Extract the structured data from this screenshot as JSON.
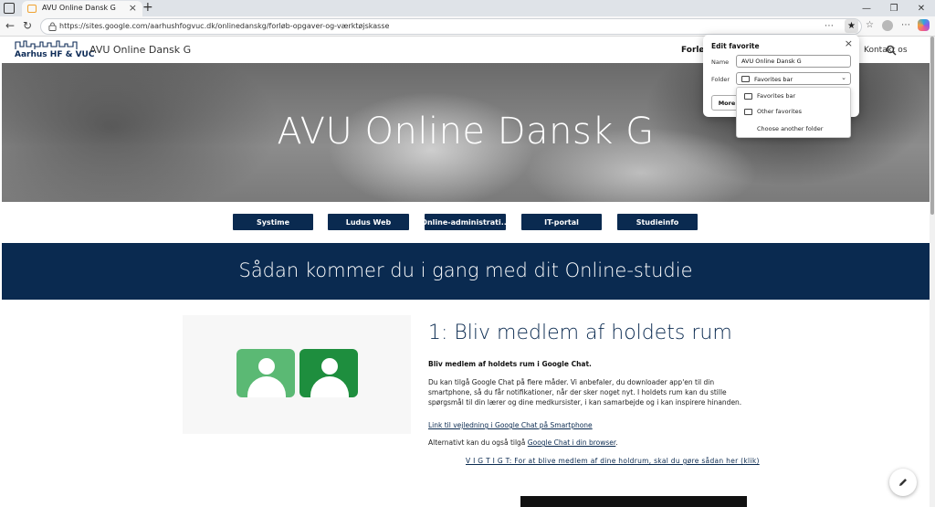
{
  "browser": {
    "tab_title": "AVU Online Dansk G",
    "url": "https://sites.google.com/aarhushfogvuc.dk/onlinedanskg/forløb-opgaver-og-værktøjskasse"
  },
  "site": {
    "logo_text": "Aarhus HF & VUC",
    "title": "AVU Online Dansk G",
    "nav": {
      "partial_active": "Forløb",
      "contact": "Kontakt os"
    }
  },
  "hero": {
    "title": "AVU Online Dansk G"
  },
  "buttons": [
    "Systime",
    "Ludus Web",
    "Online-administrati...",
    "IT-portal",
    "Studieinfo"
  ],
  "banner": {
    "text": "Sådan kommer du i gang med dit Online-studie"
  },
  "section": {
    "heading": "1: Bliv medlem af holdets rum",
    "bold_intro": "Bliv medlem af holdets rum i Google Chat.",
    "paragraph": "Du kan tilgå Google Chat på flere måder. Vi anbefaler, du downloader app'en til din smartphone, så du får notifikationer, når der sker noget nyt. I holdets rum kan du stille spørgsmål til din lærer og dine medkursister, i kan samarbejde og i kan inspirere hinanden.",
    "link_smartphone": "Link til vejledning i Google Chat på Smartphone",
    "alt_prefix": "Alternativt kan du også tilgå ",
    "alt_link": "Google Chat i din browser",
    "alt_suffix": ".",
    "important_link": "V I G T I G T: For at blive medlem af dine holdrum, skal du gøre sådan her (klik)"
  },
  "favorite_popup": {
    "title": "Edit favorite",
    "name_label": "Name",
    "name_value": "AVU Online Dansk G",
    "folder_label": "Folder",
    "folder_value": "Favorites bar",
    "more_button": "More",
    "folder_options": [
      "Favorites bar",
      "Other favorites",
      "Choose another folder"
    ]
  },
  "colors": {
    "navy": "#0a2a50",
    "chat_green_light": "#5bb974",
    "chat_green_dark": "#1e8e3e"
  }
}
